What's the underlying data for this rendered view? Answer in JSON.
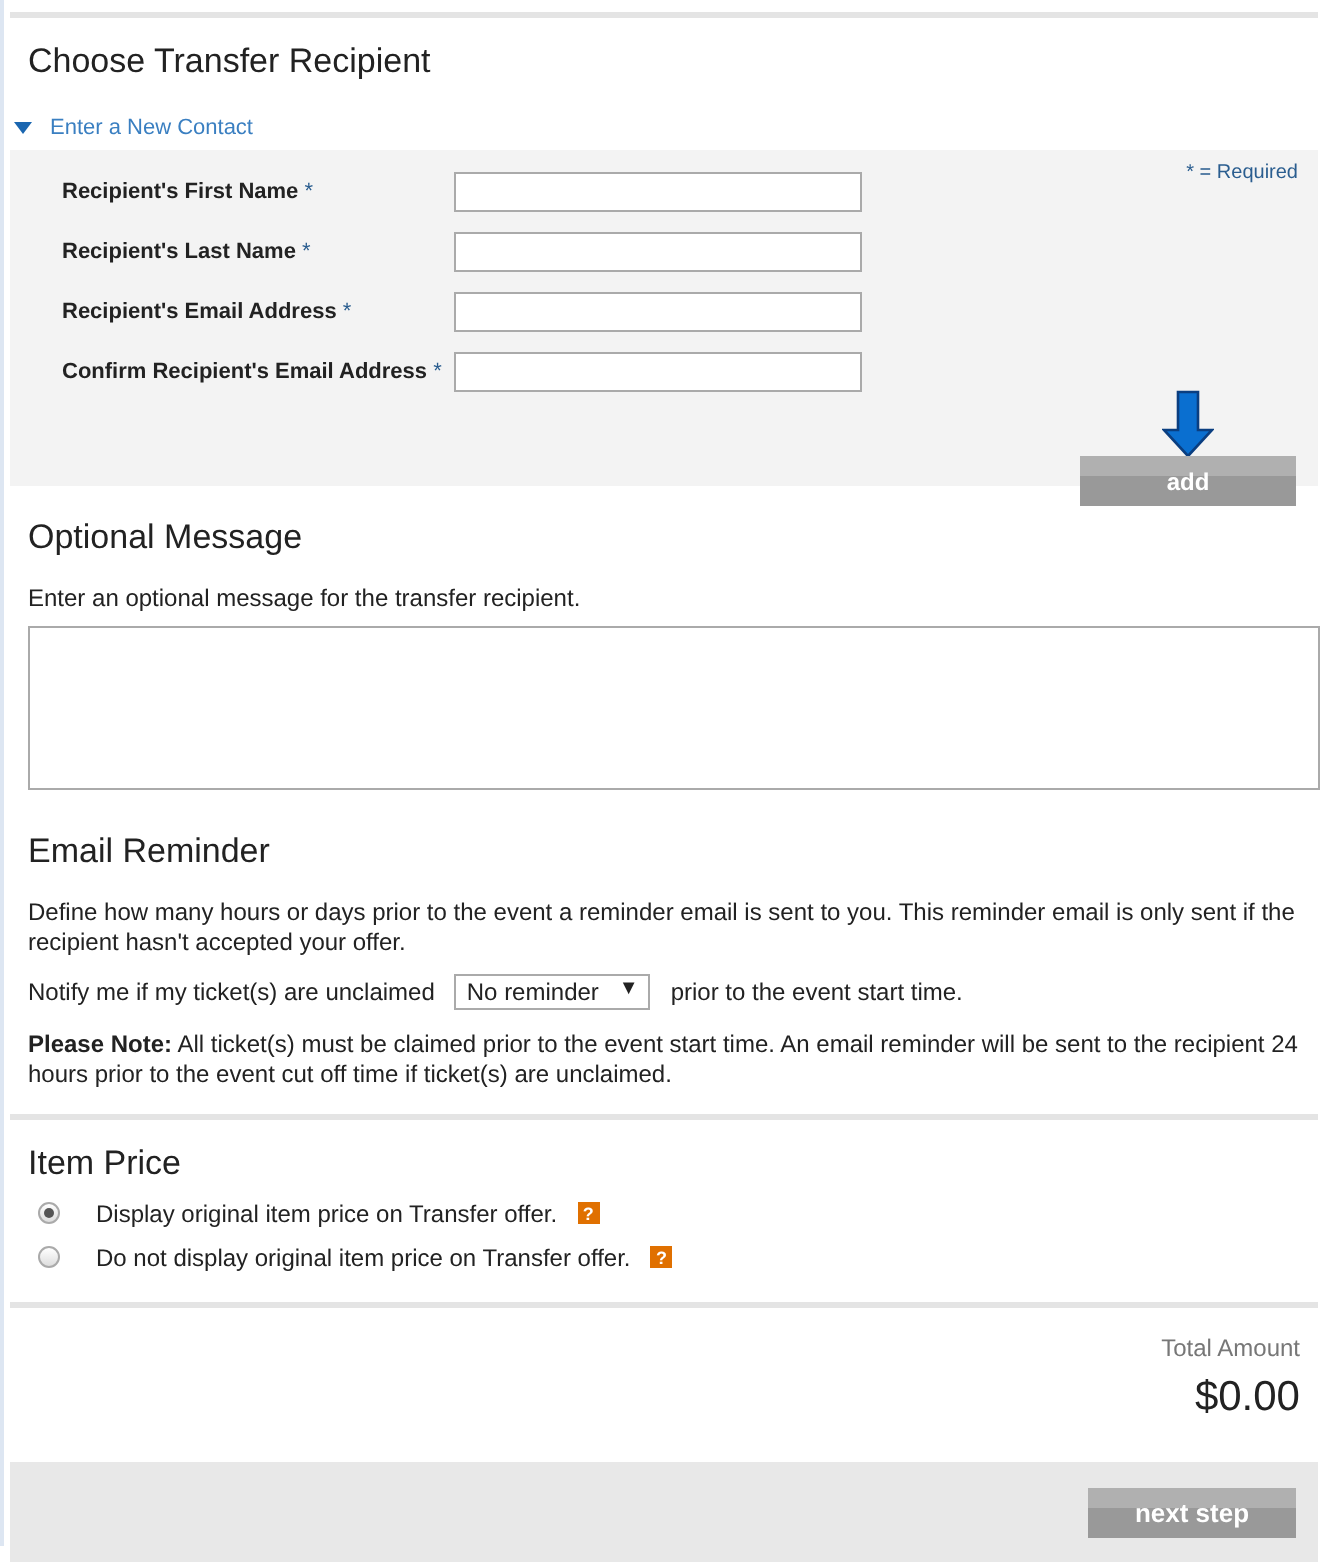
{
  "recipient": {
    "title": "Choose Transfer Recipient",
    "toggle": {
      "label": "Enter a New Contact",
      "expanded": true
    },
    "required_note": "* = Required",
    "fields": [
      {
        "label": "Recipient's First Name",
        "required_mark": "*"
      },
      {
        "label": "Recipient's Last Name",
        "required_mark": "*"
      },
      {
        "label": "Recipient's Email Address",
        "required_mark": "*"
      },
      {
        "label": "Confirm Recipient's Email Address",
        "required_mark": "*"
      }
    ],
    "add_button": "add"
  },
  "message": {
    "title": "Optional Message",
    "hint": "Enter an optional message for the transfer recipient."
  },
  "reminder": {
    "title": "Email Reminder",
    "description": "Define how many hours or days prior to the event a reminder email is sent to you. This reminder email is only sent if the recipient hasn't accepted your offer.",
    "notify_before": "Notify me if my ticket(s) are unclaimed",
    "select": "No reminder",
    "select_caret": "▼",
    "notify_after": "prior to the event start time.",
    "note": "**Please Note:** All ticket(s) must be claimed prior to the event start time. An email reminder will be sent to the recipient 24 hours prior to the event cut off time if ticket(s) are unclaimed."
  },
  "item_price": {
    "title": "Item Price",
    "options": [
      {
        "label": "Display original item price on Transfer offer.",
        "selected": true,
        "help": "?"
      },
      {
        "label": "Do not display original item price on Transfer offer.",
        "selected": false,
        "help": "?"
      }
    ]
  },
  "total": {
    "label": "Total Amount",
    "amount": "$0.00"
  },
  "footer": {
    "next_button": "next step"
  }
}
